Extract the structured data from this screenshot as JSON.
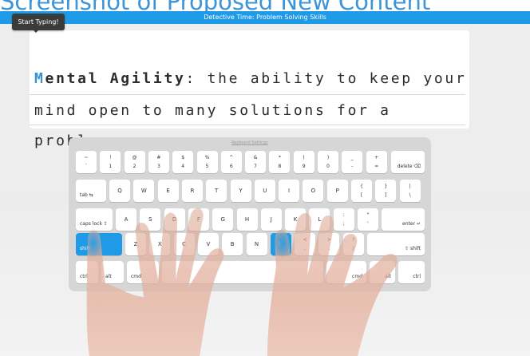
{
  "slide": {
    "caption": "Screenshot of Proposed New Content"
  },
  "app": {
    "title": "Detective Time: Problem Solving Skills"
  },
  "tooltip": {
    "text": "Start Typing!"
  },
  "passage": {
    "cursor_char": "M",
    "term_rest": "ental Agility",
    "line1_rest": ": the ability to keep your",
    "line2": "mind open to many solutions for a",
    "line3": "problem."
  },
  "keyboard": {
    "settings_label": "Keyboard Settings",
    "row1": [
      {
        "top": "~",
        "bottom": "`"
      },
      {
        "top": "!",
        "bottom": "1"
      },
      {
        "top": "@",
        "bottom": "2"
      },
      {
        "top": "#",
        "bottom": "3"
      },
      {
        "top": "$",
        "bottom": "4"
      },
      {
        "top": "%",
        "bottom": "5"
      },
      {
        "top": "^",
        "bottom": "6"
      },
      {
        "top": "&",
        "bottom": "7"
      },
      {
        "top": "*",
        "bottom": "8"
      },
      {
        "top": "(",
        "bottom": "9"
      },
      {
        "top": ")",
        "bottom": "0"
      },
      {
        "top": "_",
        "bottom": "-"
      },
      {
        "top": "+",
        "bottom": "="
      }
    ],
    "delete_label": "delete ⌫",
    "tab_label": "tab ⇆",
    "row2": [
      "Q",
      "W",
      "E",
      "R",
      "T",
      "Y",
      "U",
      "I",
      "O",
      "P"
    ],
    "row2_sym": [
      {
        "top": "{",
        "bottom": "["
      },
      {
        "top": "}",
        "bottom": "]"
      },
      {
        "top": "|",
        "bottom": "\\"
      }
    ],
    "caps_label": "caps lock ⇪",
    "row3": [
      "A",
      "S",
      "D",
      "F",
      "G",
      "H",
      "J",
      "K",
      "L"
    ],
    "row3_sym": [
      {
        "top": ":",
        "bottom": ";"
      },
      {
        "top": "\"",
        "bottom": "'"
      }
    ],
    "enter_label": "enter ↵",
    "shift_left_label": "shift",
    "row4": [
      "Z",
      "X",
      "C",
      "V",
      "B",
      "N",
      "M"
    ],
    "row4_sym": [
      {
        "top": "<",
        "bottom": ","
      },
      {
        "top": ">",
        "bottom": "."
      },
      {
        "top": "?",
        "bottom": "/"
      }
    ],
    "shift_right_label": "⇧ shift",
    "ctrl_label": "ctrl",
    "alt_label": "alt",
    "cmd_label": "cmd",
    "active_keys": [
      "shift-left",
      "M"
    ],
    "active_color": "#1e9ae6"
  }
}
